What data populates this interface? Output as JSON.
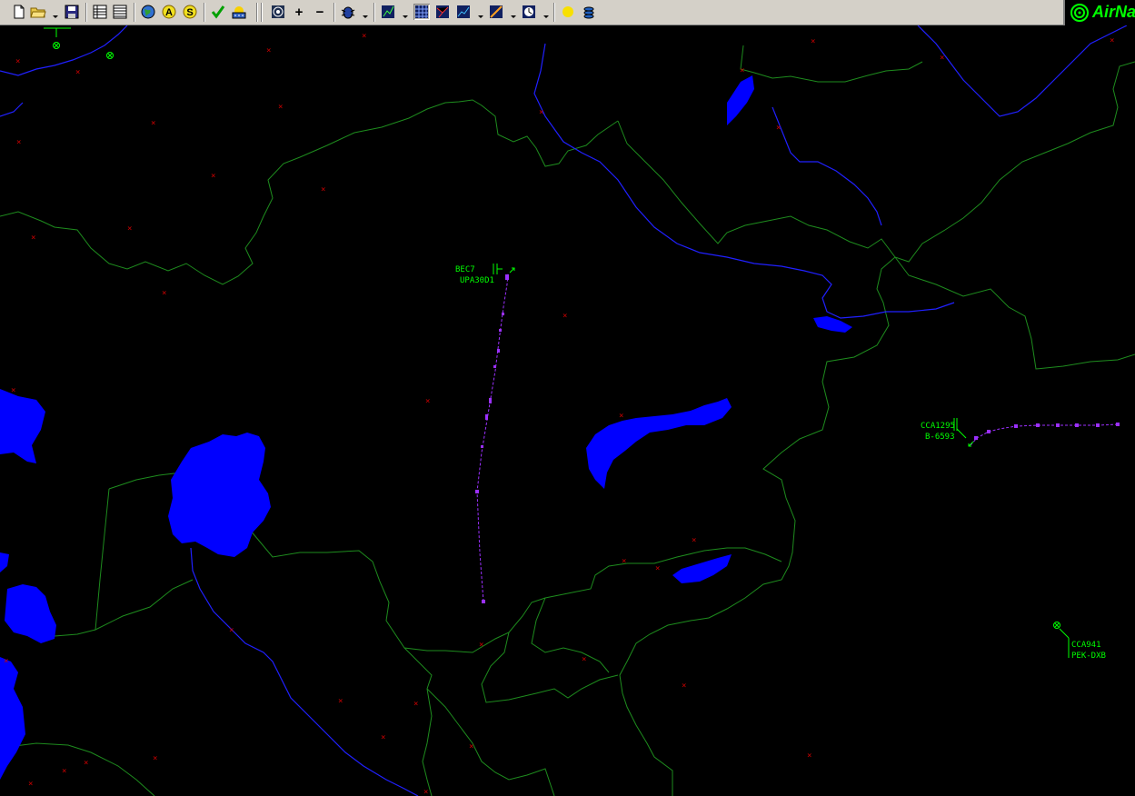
{
  "window": {
    "brand_name": "AirNav",
    "brand_icon": "radar-logo-icon"
  },
  "toolbar": {
    "buttons": [
      {
        "name": "new-file-button",
        "icon": "new-document-icon"
      },
      {
        "name": "open-file-button",
        "icon": "open-folder-icon",
        "has_dropdown": true
      },
      {
        "name": "save-button",
        "icon": "floppy-disk-icon"
      },
      {
        "name": "flight-list-button",
        "icon": "list-table-icon"
      },
      {
        "name": "flight-details-button",
        "icon": "detail-table-icon"
      },
      {
        "name": "map-layers-button",
        "icon": "globe-icon"
      },
      {
        "name": "airports-button",
        "icon": "letter-a-icon",
        "glyph": "A"
      },
      {
        "name": "sectors-button",
        "icon": "letter-s-icon",
        "glyph": "S"
      },
      {
        "name": "validate-button",
        "icon": "checkmark-icon"
      },
      {
        "name": "weather-button",
        "icon": "weather-icon"
      },
      {
        "name": "zoom-fit-button",
        "icon": "target-icon"
      },
      {
        "name": "zoom-in-button",
        "icon": "plus-icon",
        "glyph": "+"
      },
      {
        "name": "zoom-out-button",
        "icon": "minus-icon",
        "glyph": "−"
      },
      {
        "name": "filter-button",
        "icon": "bug-icon",
        "has_dropdown": true
      },
      {
        "name": "trail-button",
        "icon": "trail-icon",
        "has_dropdown": true
      },
      {
        "name": "grid-button",
        "icon": "grid-icon",
        "pressed": true
      },
      {
        "name": "routes-button",
        "icon": "routes-icon"
      },
      {
        "name": "altitude-button",
        "icon": "chart-icon",
        "has_dropdown": true
      },
      {
        "name": "vector-button",
        "icon": "vector-icon",
        "has_dropdown": true
      },
      {
        "name": "clock-button",
        "icon": "clock-icon",
        "has_dropdown": true
      },
      {
        "name": "day-night-button",
        "icon": "sun-moon-icon"
      },
      {
        "name": "layers-button",
        "icon": "stack-icon"
      }
    ]
  },
  "map": {
    "colors": {
      "background": "#000000",
      "borders": "#1e8c1e",
      "water": "#0000ff",
      "airports": "#c80000",
      "labels": "#00ff00",
      "track": "#9b30ff"
    },
    "flights": [
      {
        "callsign": "BEC7",
        "info": "UPA30D1"
      },
      {
        "callsign": "CCA1295",
        "info": "B-6593"
      },
      {
        "callsign": "CCA941",
        "info": "PEK-DXB"
      }
    ]
  }
}
